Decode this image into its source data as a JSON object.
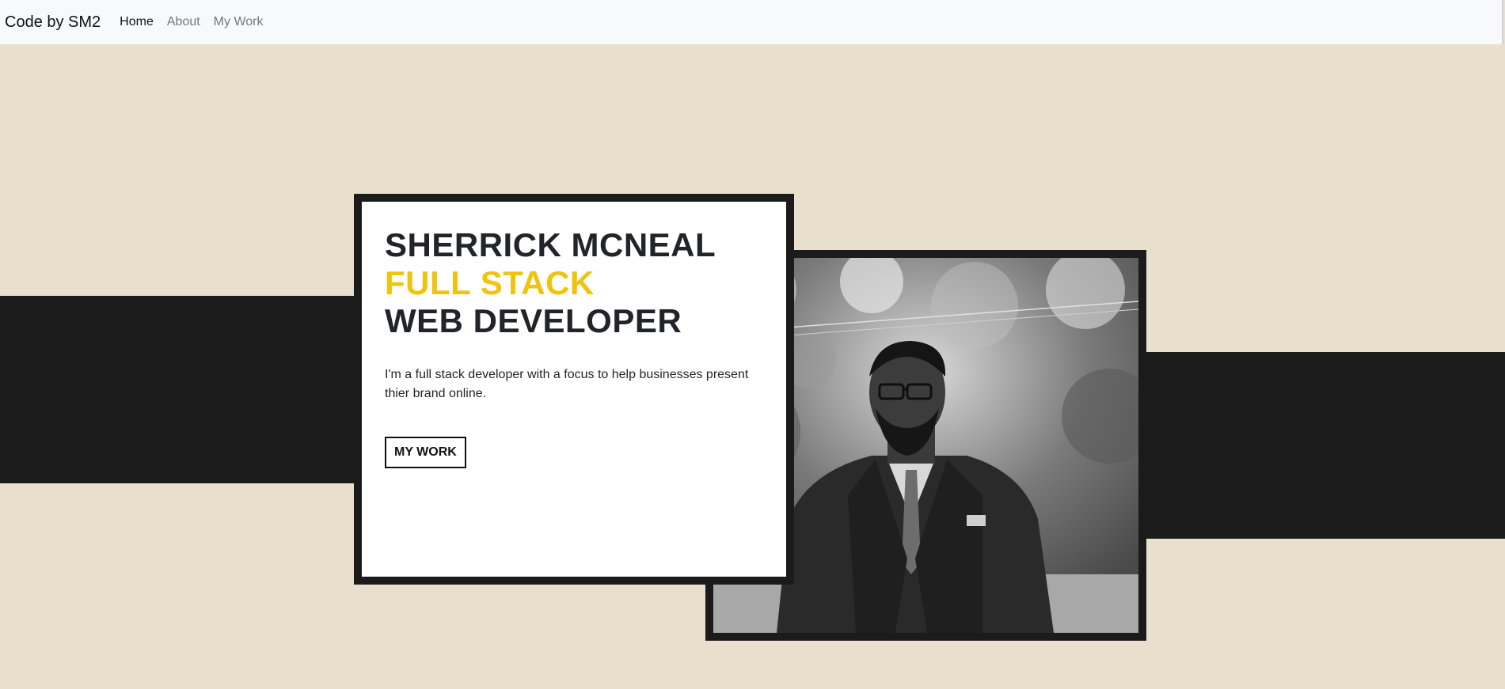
{
  "nav": {
    "brand": "Code by SM2",
    "links": [
      {
        "label": "Home",
        "active": true
      },
      {
        "label": "About",
        "active": false
      },
      {
        "label": "My Work",
        "active": false
      }
    ]
  },
  "hero": {
    "name": "SHERRICK MCNEAL",
    "role_accent": "FULL STACK",
    "role": "WEB DEVELOPER",
    "intro": "I'm a full stack developer with a focus to help businesses present thier brand online.",
    "button_label": "MY WORK"
  },
  "colors": {
    "background": "#e8dfcd",
    "dark": "#1b1b1b",
    "accent": "#f0c30f",
    "navbar": "#f8f9fa"
  }
}
